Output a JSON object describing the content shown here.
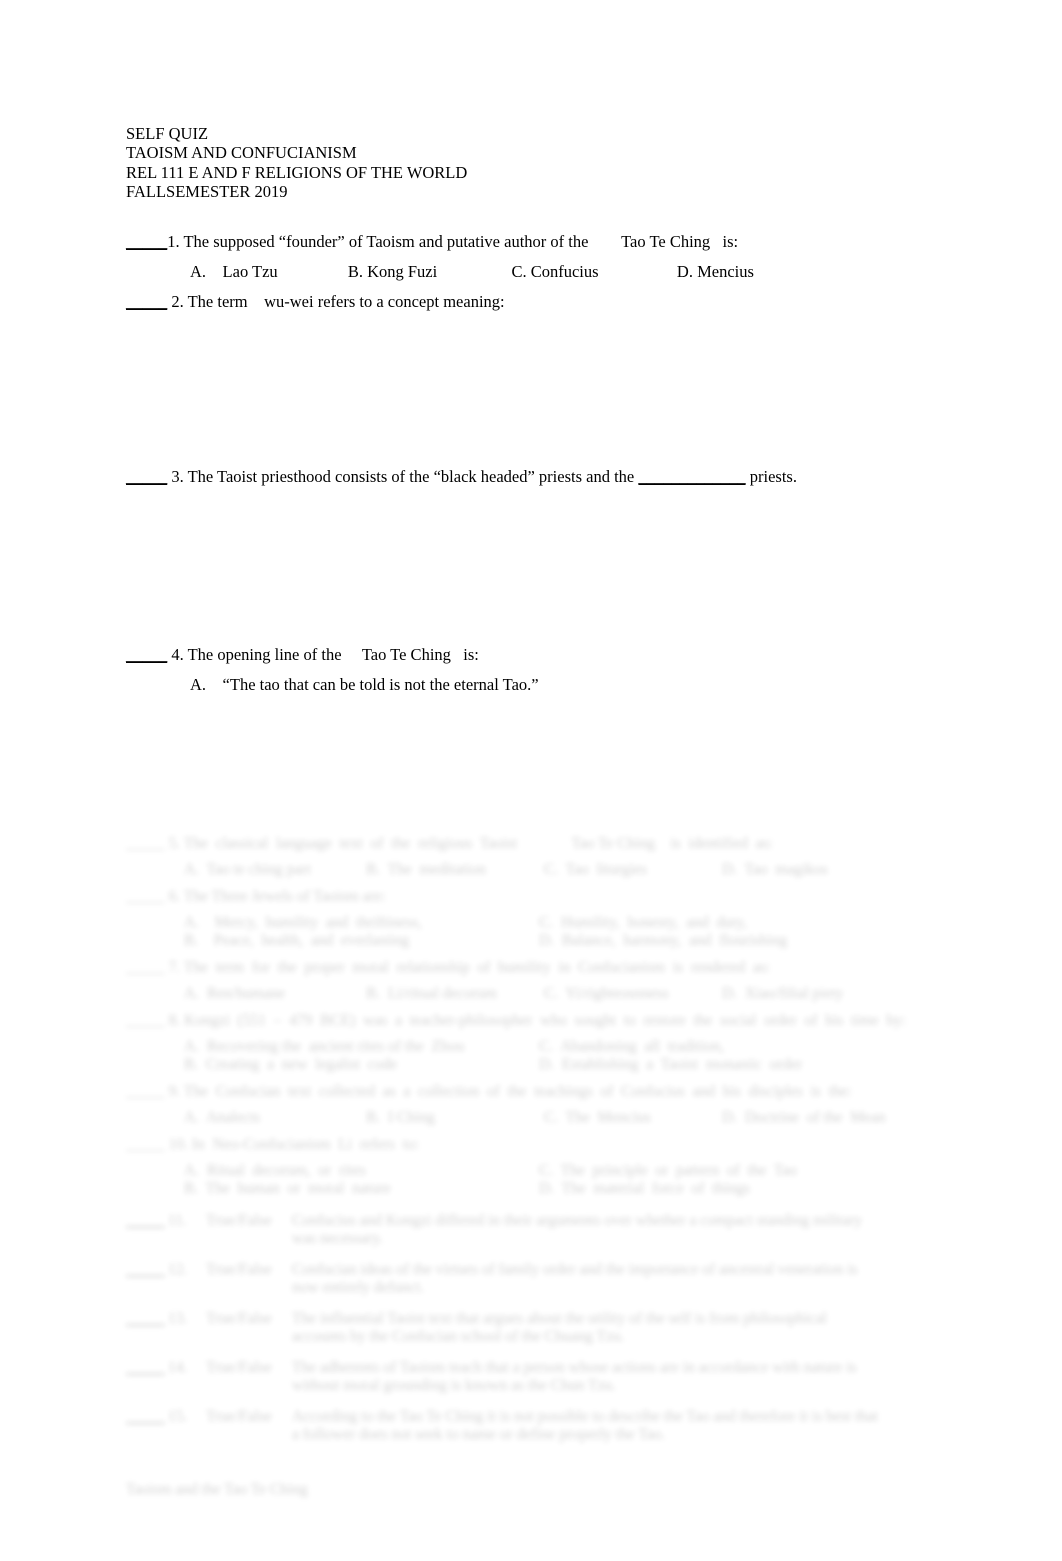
{
  "header": {
    "lines": [
      "SELF QUIZ",
      "TAOISM AND CONFUCIANISM",
      "REL 111 E AND F RELIGIONS OF THE WORLD",
      "FALLSEMESTER 2019"
    ]
  },
  "questions": {
    "q1": {
      "blank": "_____",
      "text": "1. The supposed “founder” of Taoism and putative author of the",
      "italic": "Tao Te Ching",
      "tail": "is:",
      "options": [
        "A.    Lao Tzu",
        "B. Kong Fuzi",
        "C. Confucius",
        "D. Mencius"
      ]
    },
    "q2": {
      "blank": "_____",
      "text": "2. The term",
      "italic": "wu-wei",
      "tail": "refers to a concept meaning:"
    },
    "q3": {
      "blank": "_____",
      "text": "3. The Taoist priesthood consists of the “black headed” priests and the",
      "fill_blank": "_____________",
      "tail": "priests."
    },
    "q4": {
      "blank": "_____",
      "text": "4. The opening line of the",
      "italic": "Tao Te Ching",
      "tail": "is:",
      "option_a": "A.    “The tao that can be told is not the eternal Tao.”"
    }
  },
  "faded_section": {
    "note": "lower portion of page is blurred and illegible",
    "q5": {
      "prompt": "_____ 5. The  classical  language  text  of  the  religious  Taoist              Tao Te Ching    is  identified  as:",
      "options": [
        "A.  Tao te ching part",
        "B.  The  meditation",
        "C.  Tao  liturgies",
        "D.  Tao  magikos"
      ]
    },
    "q6": {
      "prompt": "_____ 6. The Three Jewels of Taoism are:",
      "options_left": [
        "A.    Mercy,  humility  and  thriftiness,",
        "B.    Peace,  health,  and  everlasting"
      ],
      "options_right": [
        "C.  Humility,  honesty,  and  duty,",
        "D.  Balance,  harmony,  and  flourishing"
      ]
    },
    "q7": {
      "prompt": "_____ 7. The  term  for  the  proper  moral  relationship  of  humility  in  Confucianism  is  rendered  as:",
      "options": [
        "A.  Ren/humane",
        "B.  Li/ritual decorum",
        "C.  Yi/righteousness",
        "D.  Xiao/filial piety"
      ]
    },
    "q8": {
      "prompt": "_____ 8. Kongzi  (551  –  479  BCE)  was  a  teacher-philosopher  who  sought  to  restore  the  social  order  of  his  time  by:",
      "options_left": [
        "A.  Recovering the  ancient rites of the  Zhou",
        "B.  Creating  a  new  legalist  code"
      ],
      "options_right": [
        "C.  Abandoning  all  tradition,",
        "D.  Establishing  a  Taoist  monastic  order"
      ]
    },
    "q9": {
      "prompt": "_____ 9. The  Confucian  text  collected  as  a  collection  of  the  teachings  of  Confucius  and  his  disciples  is  the:",
      "options": [
        "A.  Analects",
        "B.  I Ching",
        "C.  The  Mencius",
        "D.  Doctrine  of the  Mean"
      ]
    },
    "q10": {
      "prompt": "_____ 10. In  Neo-Confucianism  Li  refers  to:",
      "options_left": [
        "A.  Ritual  decorum,  or  rites",
        "B.  The  human  or  moral  nature"
      ],
      "options_right": [
        "C.  The  principle  or  pattern  of  the  Tao",
        "D.  The  material  force  of  things"
      ]
    },
    "true_false": [
      {
        "blank": "_____",
        "number": "11.",
        "label": "True/False",
        "text": "Confucius  and  Kongzi  differed  in  their  arguments  over  whether  a  compact  standing  military  was  necessary."
      },
      {
        "blank": "_____",
        "number": "12.",
        "label": "True/False",
        "text": "Confucian  ideas  of  the  virtues  of  family  order  and  the  importance  of  ancestral  veneration  is  now  entirely  defunct."
      },
      {
        "blank": "_____",
        "number": "13.",
        "label": "True/False",
        "text": "The  influential  Taoist  text  that  argues  about  the  utility  of  the  self  is  from  philosophical  accounts  by  the  Confucian  school  of  the  Chuang  Tzu."
      },
      {
        "blank": "_____",
        "number": "14.",
        "label": "True/False",
        "text": "The  adherents  of  Taoism  teach  that  a  person  whose  actions  are  in  accordance  with  nature  is  without  moral  grounding  is  known  as  the  Chun Tzu."
      },
      {
        "blank": "_____",
        "number": "15.",
        "label": "True/False",
        "text": "According  to  the  Tao  Te  Ching  it  is  not  possible  to  describe  the  Tao  and  therefore  it  is  best  that  a  follower  does  not  seek  to  name  or  define  properly  the  Tao."
      }
    ],
    "footer": "Taoism and the Tao Te Ching"
  }
}
